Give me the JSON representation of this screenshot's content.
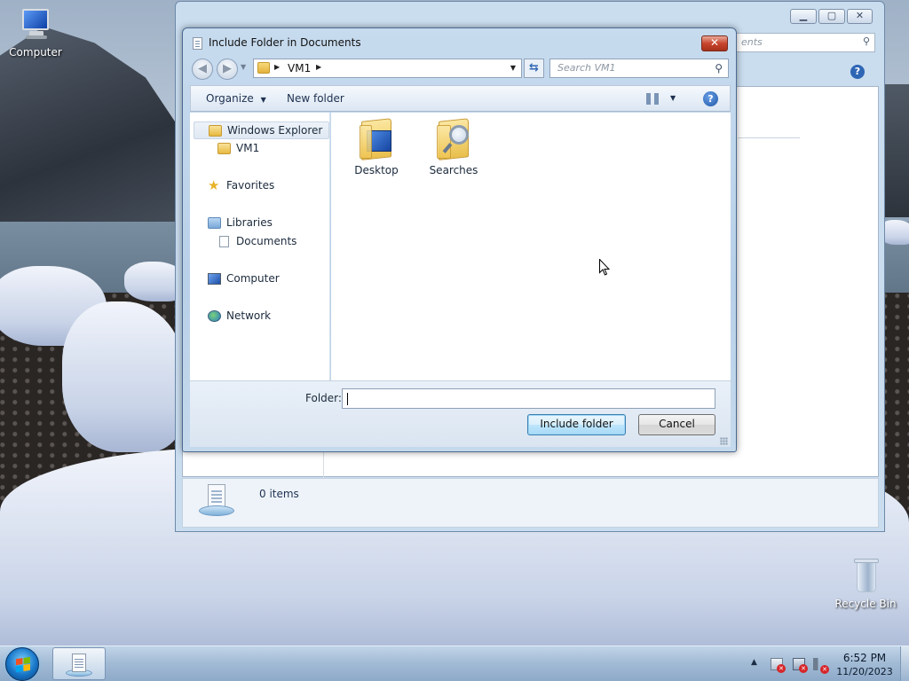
{
  "desktop": {
    "icons": [
      {
        "label": "Computer",
        "icon": "computer-icon"
      },
      {
        "label": "Recycle Bin",
        "icon": "recycle-bin-icon"
      }
    ]
  },
  "background_window": {
    "search_placeholder": "Search Documents",
    "search_visible_text": "ents",
    "details": {
      "items_count": "0 items"
    }
  },
  "dialog": {
    "title": "Include Folder in Documents",
    "address": {
      "path": "VM1",
      "icon": "user-folder-icon"
    },
    "search": {
      "placeholder": "Search VM1"
    },
    "toolbar": {
      "organize_label": "Organize",
      "new_folder_label": "New folder",
      "views_icon": "change-view-icon",
      "help_icon": "help-icon"
    },
    "nav_tree": [
      {
        "label": "Windows Explorer",
        "icon": "folder-icon",
        "selected": true,
        "indent": 0
      },
      {
        "label": "VM1",
        "icon": "user-folder-icon",
        "selected": false,
        "indent": 1
      },
      {
        "label": "Favorites",
        "icon": "star-icon",
        "selected": false,
        "indent": 0
      },
      {
        "label": "Libraries",
        "icon": "libraries-icon",
        "selected": false,
        "indent": 0
      },
      {
        "label": "Documents",
        "icon": "documents-icon",
        "selected": false,
        "indent": 1
      },
      {
        "label": "Computer",
        "icon": "computer-icon",
        "selected": false,
        "indent": 0
      },
      {
        "label": "Network",
        "icon": "network-icon",
        "selected": false,
        "indent": 0
      }
    ],
    "files": [
      {
        "label": "Desktop",
        "icon": "desktop-folder-icon"
      },
      {
        "label": "Searches",
        "icon": "searches-folder-icon"
      }
    ],
    "folder_field": {
      "label": "Folder:",
      "value": ""
    },
    "buttons": {
      "include_folder": "Include folder",
      "cancel": "Cancel"
    },
    "close_glyph": "✕"
  },
  "taskbar": {
    "time": "6:52 PM",
    "date": "11/20/2023",
    "tray_icons": [
      "action-center-icon",
      "network-icon",
      "volume-icon"
    ]
  },
  "colors": {
    "accent": "#3c7fb1",
    "close_red": "#c8452d",
    "taskbar": "#9cb6d2"
  }
}
